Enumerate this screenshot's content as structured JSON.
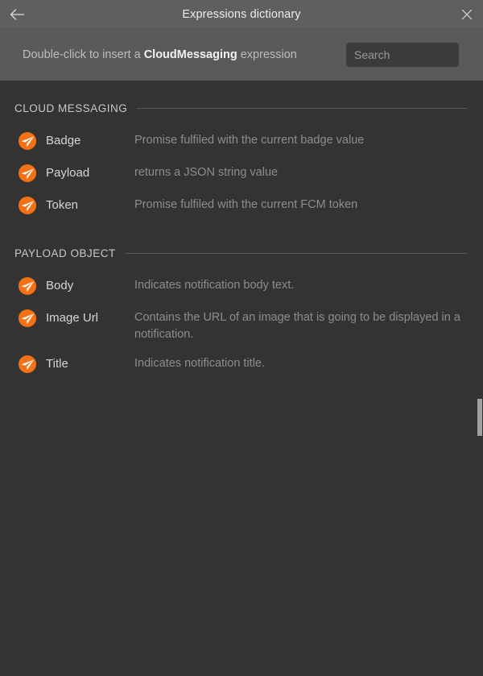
{
  "window": {
    "title": "Expressions dictionary",
    "back_icon": "arrow-left-icon",
    "close_icon": "close-icon"
  },
  "subheader": {
    "hint_prefix": "Double-click to insert a ",
    "hint_strong": "CloudMessaging",
    "hint_suffix": " expression",
    "search_placeholder": "Search",
    "search_value": ""
  },
  "colors": {
    "titlebar_bg": "#5f5f5f",
    "subheader_bg": "#5a5a5a",
    "body_bg": "#333333",
    "accent_orange": "#f47216",
    "icon_glyph": "#ffffff",
    "label_text": "#d6d6d6",
    "desc_text": "#8d8d8d",
    "section_rule": "#5a5a5a",
    "scrollbar_thumb": "#a0a0a0"
  },
  "sections": [
    {
      "title": "CLOUD MESSAGING",
      "items": [
        {
          "icon": "expression-send-icon",
          "name": "Badge",
          "description": "Promise fulfiled with the current badge value"
        },
        {
          "icon": "expression-send-icon",
          "name": "Payload",
          "description": "returns a JSON string value"
        },
        {
          "icon": "expression-send-icon",
          "name": "Token",
          "description": "Promise fulfiled with the current FCM token"
        }
      ]
    },
    {
      "title": "PAYLOAD OBJECT",
      "items": [
        {
          "icon": "expression-send-icon",
          "name": "Body",
          "description": "Indicates notification body text."
        },
        {
          "icon": "expression-send-icon",
          "name": "Image Url",
          "description": "Contains the URL of an image that is going to be displayed in a notification."
        },
        {
          "icon": "expression-send-icon",
          "name": "Title",
          "description": "Indicates notification title."
        }
      ]
    }
  ]
}
